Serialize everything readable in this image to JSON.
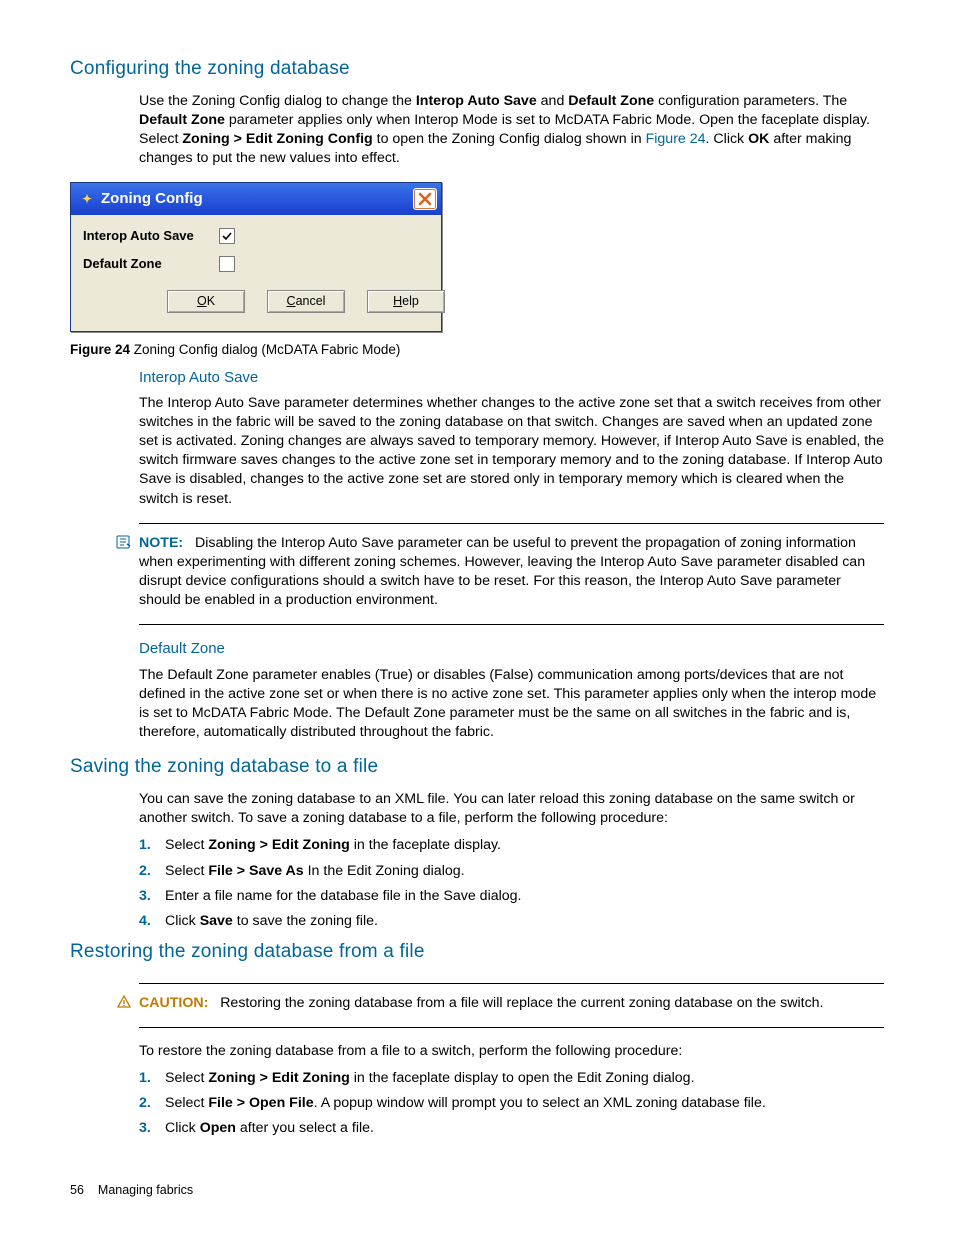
{
  "sections": {
    "configuring": {
      "heading": "Configuring the zoning database",
      "intro_parts": [
        "Use the Zoning Config dialog to change the ",
        "Interop Auto Save",
        " and ",
        "Default Zone",
        " configuration parameters. The ",
        "Default Zone",
        " parameter applies only when Interop Mode is set to McDATA Fabric Mode. Open the faceplate display. Select ",
        "Zoning > Edit Zoning Config",
        " to open the Zoning Config dialog shown in ",
        "Figure 24",
        ". Click ",
        "OK",
        " after making changes to put the new values into effect."
      ]
    },
    "dialog": {
      "title": "Zoning Config",
      "rows": {
        "interop_label": "Interop Auto Save",
        "interop_checked": true,
        "default_label": "Default Zone",
        "default_checked": false
      },
      "buttons": {
        "ok": "OK",
        "cancel": "Cancel",
        "help": "Help"
      }
    },
    "figure_caption": {
      "label": "Figure 24",
      "text": "  Zoning Config dialog (McDATA Fabric Mode)"
    },
    "interop": {
      "heading": "Interop Auto Save",
      "body": "The Interop Auto Save parameter determines whether changes to the active zone set that a switch receives from other switches in the fabric will be saved to the zoning database on that switch. Changes are saved when an updated zone set is activated. Zoning changes are always saved to temporary memory. However, if Interop Auto Save is enabled, the switch firmware saves changes to the active zone set in temporary memory and to the zoning database. If Interop Auto Save is disabled, changes to the active zone set are stored only in temporary memory which is cleared when the switch is reset."
    },
    "note": {
      "label": "NOTE:",
      "body": "Disabling the Interop Auto Save parameter can be useful to prevent the propagation of zoning information when experimenting with different zoning schemes. However, leaving the Interop Auto Save parameter disabled can disrupt device configurations should a switch have to be reset. For this reason, the Interop Auto Save parameter should be enabled in a production environment."
    },
    "default_zone": {
      "heading": "Default Zone",
      "body": "The Default Zone parameter enables (True) or disables (False) communication among ports/devices that are not defined in the active zone set or when there is no active zone set. This parameter applies only when the interop mode is set to McDATA Fabric Mode. The Default Zone parameter must be the same on all switches in the fabric and is, therefore, automatically distributed throughout the fabric."
    },
    "saving": {
      "heading": "Saving the zoning database to a file",
      "intro": "You can save the zoning database to an XML file. You can later reload this zoning database on the same switch or another switch. To save a zoning database to a file, perform the following procedure:",
      "steps": [
        {
          "pre": "Select ",
          "b": "Zoning > Edit Zoning",
          "post": " in the faceplate display."
        },
        {
          "pre": "Select ",
          "b": "File > Save As",
          "post": " In the Edit Zoning dialog."
        },
        {
          "pre": "Enter a file name for the database file in the Save dialog.",
          "b": "",
          "post": ""
        },
        {
          "pre": "Click ",
          "b": "Save",
          "post": " to save the zoning file."
        }
      ]
    },
    "restoring": {
      "heading": "Restoring the zoning database from a file",
      "caution": {
        "label": "CAUTION:",
        "body": "Restoring the zoning database from a file will replace the current zoning database on the switch."
      },
      "intro": "To restore the zoning database from a file to a switch, perform the following procedure:",
      "steps": [
        {
          "pre": "Select ",
          "b": "Zoning > Edit Zoning",
          "post": " in the faceplate display to open the Edit Zoning dialog."
        },
        {
          "pre": "Select ",
          "b": "File > Open File",
          "post": ". A popup window will prompt you to select an XML zoning database file."
        },
        {
          "pre": "Click ",
          "b": "Open",
          "post": " after you select a file."
        }
      ]
    }
  },
  "footer": {
    "page": "56",
    "chapter": "Managing fabrics"
  }
}
